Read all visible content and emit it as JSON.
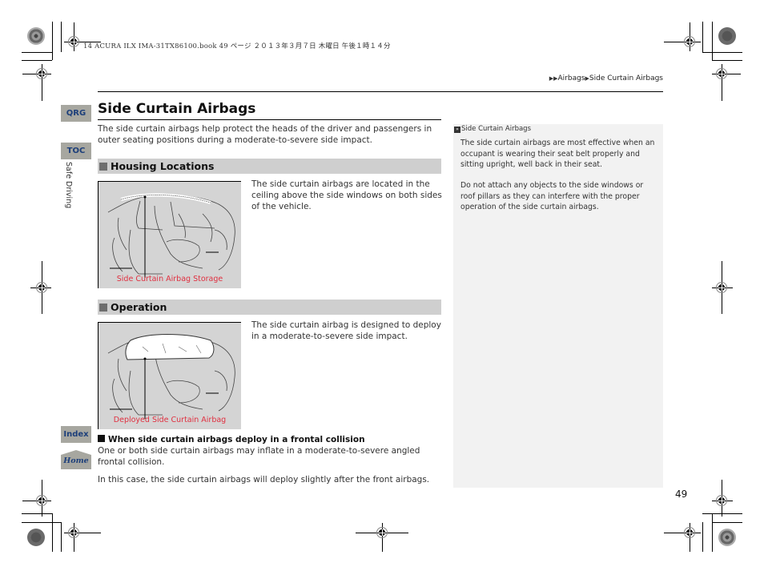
{
  "print_header": "14 ACURA ILX IMA-31TX86100.book  49 ページ  ２０１３年３月７日  木曜日  午後１時１４分",
  "breadcrumb": {
    "prefix_icon": "double-right-triangle-icon",
    "items": [
      "Airbags",
      "Side Curtain Airbags"
    ],
    "separator_icon": "right-triangle-icon"
  },
  "nav": {
    "qrg": "QRG",
    "toc": "TOC",
    "section": "Safe Driving",
    "index": "Index",
    "home": "Home"
  },
  "page": {
    "title": "Side Curtain Airbags",
    "intro": "The side curtain airbags help protect the heads of the driver and passengers in outer seating positions during a moderate-to-severe side impact.",
    "sections": [
      {
        "heading": "Housing Locations",
        "text": "The side curtain airbags are located in the ceiling above the side windows on both sides of the vehicle.",
        "figure_caption": "Side Curtain Airbag Storage"
      },
      {
        "heading": "Operation",
        "text": "The side curtain airbag is designed to deploy in a moderate-to-severe side impact.",
        "figure_caption": "Deployed Side Curtain Airbag"
      }
    ],
    "subsection": {
      "heading": "When side curtain airbags deploy in a frontal collision",
      "paragraphs": [
        "One or both side curtain airbags may inflate in a moderate-to-severe angled frontal collision.",
        "In this case, the side curtain airbags will deploy slightly after the front airbags."
      ]
    },
    "page_number": "49"
  },
  "note": {
    "title_icon": "note-marker-icon",
    "title": "Side Curtain Airbags",
    "paragraphs": [
      "The side curtain airbags are most effective when an occupant is wearing their seat belt properly and sitting upright, well back in their seat.",
      "Do not attach any objects to the side windows or roof pillars as they can interfere with the proper operation of the side curtain airbags."
    ]
  },
  "colors": {
    "nav_tab_bg": "#a7a7a0",
    "nav_tab_text": "#1d3f7a",
    "section_header_bg": "#cfcfcf",
    "figure_caption": "#e03040",
    "note_bg": "#f2f2f2"
  }
}
